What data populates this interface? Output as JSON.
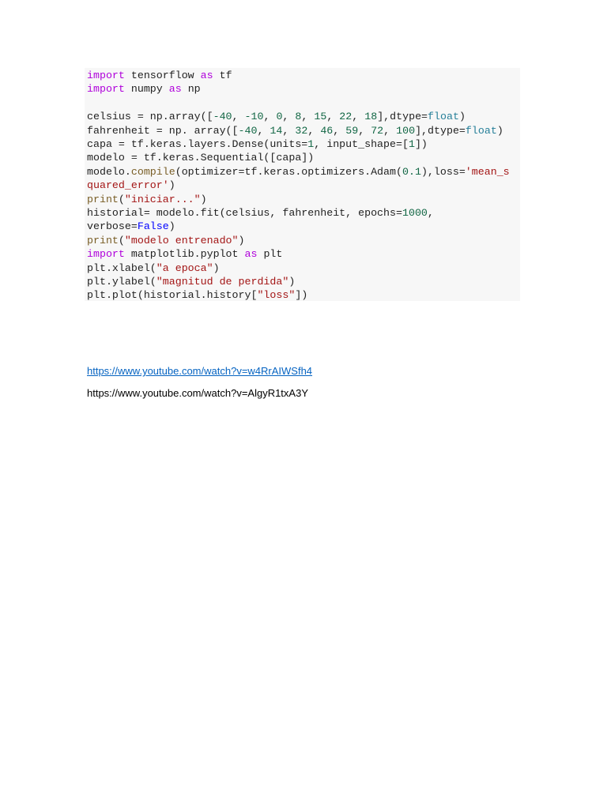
{
  "code_lines": [
    [
      [
        "kw",
        "import"
      ],
      [
        "t",
        " tensorflow "
      ],
      [
        "kw",
        "as"
      ],
      [
        "t",
        " tf"
      ]
    ],
    [
      [
        "kw",
        "import"
      ],
      [
        "t",
        " numpy "
      ],
      [
        "kw",
        "as"
      ],
      [
        "t",
        " np"
      ]
    ],
    [],
    [
      [
        "t",
        "celsius = np.array(["
      ],
      [
        "num",
        "-40"
      ],
      [
        "t",
        ", "
      ],
      [
        "num",
        "-10"
      ],
      [
        "t",
        ", "
      ],
      [
        "num",
        "0"
      ],
      [
        "t",
        ", "
      ],
      [
        "num",
        "8"
      ],
      [
        "t",
        ", "
      ],
      [
        "num",
        "15"
      ],
      [
        "t",
        ", "
      ],
      [
        "num",
        "22"
      ],
      [
        "t",
        ", "
      ],
      [
        "num",
        "18"
      ],
      [
        "t",
        "],dtype="
      ],
      [
        "ty",
        "float"
      ],
      [
        "t",
        ")"
      ]
    ],
    [
      [
        "t",
        "fahrenheit = np. array(["
      ],
      [
        "num",
        "-40"
      ],
      [
        "t",
        ", "
      ],
      [
        "num",
        "14"
      ],
      [
        "t",
        ", "
      ],
      [
        "num",
        "32"
      ],
      [
        "t",
        ", "
      ],
      [
        "num",
        "46"
      ],
      [
        "t",
        ", "
      ],
      [
        "num",
        "59"
      ],
      [
        "t",
        ", "
      ],
      [
        "num",
        "72"
      ],
      [
        "t",
        ", "
      ],
      [
        "num",
        "100"
      ],
      [
        "t",
        "],dtype="
      ],
      [
        "ty",
        "float"
      ],
      [
        "t",
        ")"
      ]
    ],
    [
      [
        "t",
        "capa = tf.keras.layers.Dense(units="
      ],
      [
        "num",
        "1"
      ],
      [
        "t",
        ", input_shape=["
      ],
      [
        "num",
        "1"
      ],
      [
        "t",
        "])"
      ]
    ],
    [
      [
        "t",
        "modelo = tf.keras.Sequential([capa])"
      ]
    ],
    [
      [
        "t",
        "modelo."
      ],
      [
        "fn",
        "compile"
      ],
      [
        "t",
        "(optimizer=tf.keras.optimizers.Adam("
      ],
      [
        "num",
        "0.1"
      ],
      [
        "t",
        "),loss="
      ],
      [
        "str",
        "'mean_s"
      ]
    ],
    [
      [
        "str",
        "quared_error'"
      ],
      [
        "t",
        ")"
      ]
    ],
    [
      [
        "fn",
        "print"
      ],
      [
        "t",
        "("
      ],
      [
        "str",
        "\"iniciar...\""
      ],
      [
        "t",
        ")"
      ]
    ],
    [
      [
        "t",
        "historial= modelo.fit(celsius, fahrenheit, epochs="
      ],
      [
        "num",
        "1000"
      ],
      [
        "t",
        ","
      ]
    ],
    [
      [
        "t",
        "verbose="
      ],
      [
        "cst",
        "False"
      ],
      [
        "t",
        ")"
      ]
    ],
    [
      [
        "fn",
        "print"
      ],
      [
        "t",
        "("
      ],
      [
        "str",
        "\"modelo entrenado\""
      ],
      [
        "t",
        ")"
      ]
    ],
    [
      [
        "kw",
        "import"
      ],
      [
        "t",
        " matplotlib.pyplot "
      ],
      [
        "kw",
        "as"
      ],
      [
        "t",
        " plt"
      ]
    ],
    [
      [
        "t",
        "plt.xlabel("
      ],
      [
        "str",
        "\"a epoca\""
      ],
      [
        "t",
        ")"
      ]
    ],
    [
      [
        "t",
        "plt.ylabel("
      ],
      [
        "str",
        "\"magnitud de perdida\""
      ],
      [
        "t",
        ")"
      ]
    ],
    [
      [
        "t",
        "plt.plot(historial.history["
      ],
      [
        "str",
        "\"loss\""
      ],
      [
        "t",
        "])"
      ]
    ]
  ],
  "links": {
    "link1": "https://www.youtube.com/watch?v=w4RrAIWSfh4",
    "link2": "https://www.youtube.com/watch?v=AlgyR1txA3Y"
  }
}
